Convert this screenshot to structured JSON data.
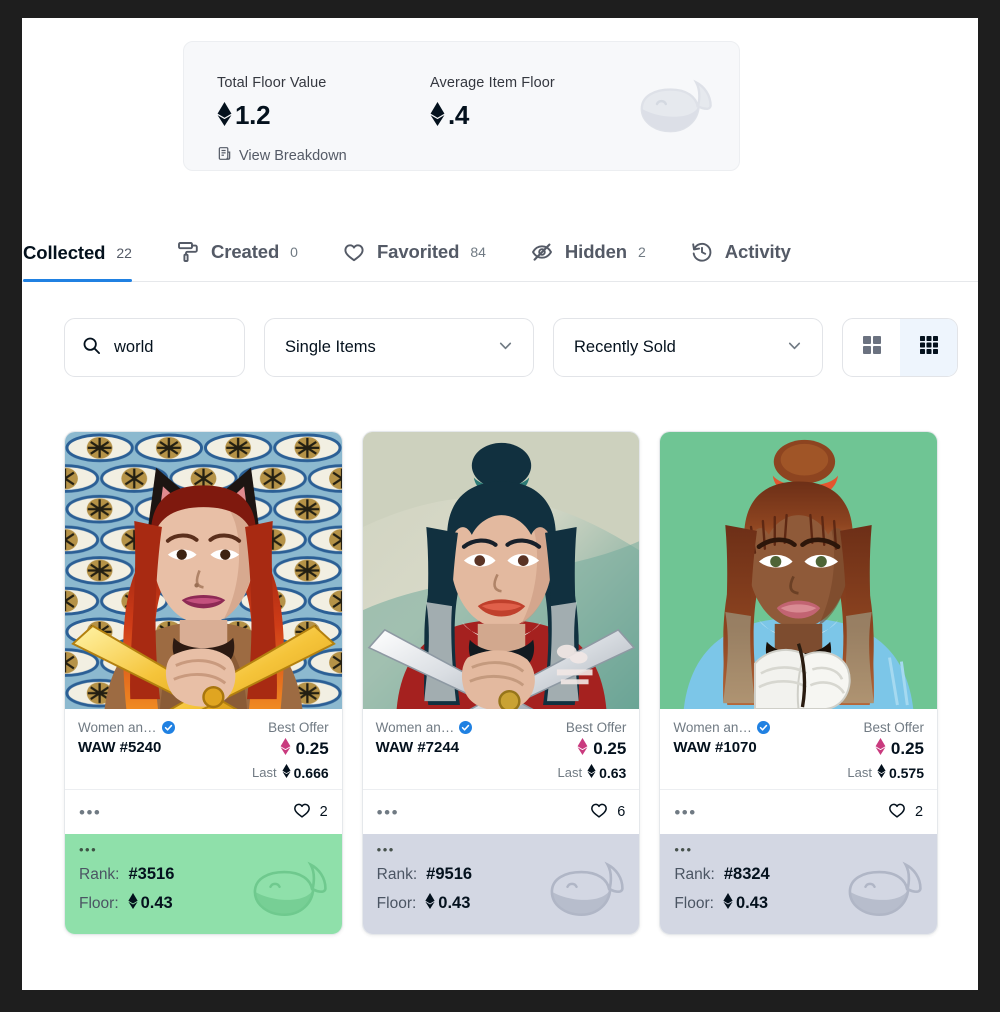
{
  "stats": {
    "total_floor_label": "Total Floor Value",
    "total_floor_value": "1.2",
    "avg_floor_label": "Average Item Floor",
    "avg_floor_value": ".4",
    "breakdown_label": "View Breakdown",
    "eth_symbol": "♦"
  },
  "tabs": [
    {
      "label": "Collected",
      "count": "22",
      "icon": "none",
      "active": true
    },
    {
      "label": "Created",
      "count": "0",
      "icon": "paint-roller-icon",
      "active": false
    },
    {
      "label": "Favorited",
      "count": "84",
      "icon": "heart-icon",
      "active": false
    },
    {
      "label": "Hidden",
      "count": "2",
      "icon": "eye-off-icon",
      "active": false
    },
    {
      "label": "Activity",
      "count": "",
      "icon": "history-icon",
      "active": false
    }
  ],
  "filters": {
    "search_value": "world",
    "search_placeholder": "Search",
    "item_type": "Single Items",
    "sort_by": "Recently Sold",
    "view_large_active": false,
    "view_small_active": true
  },
  "labels": {
    "best_offer": "Best Offer",
    "last": "Last",
    "rank": "Rank:",
    "floor": "Floor:",
    "dots": "•••"
  },
  "colors": {
    "accent": "#2081e2",
    "verified_blue": "#2081e2",
    "offer_pink": "#c93a7e",
    "rank_highlight_green": "#8fe0aa",
    "rank_default_gray": "#d3d7e3"
  },
  "cards": [
    {
      "collection": "Women an…",
      "name": "WAW #5240",
      "best_offer_price": "0.25",
      "last_price": "0.666",
      "fav_count": "2",
      "rank": "#3516",
      "floor": "0.43",
      "rank_bar_color": "#8fe0aa",
      "art": "orange-cat-ears-swords"
    },
    {
      "collection": "Women an…",
      "name": "WAW #7244",
      "best_offer_price": "0.25",
      "last_price": "0.63",
      "fav_count": "6",
      "rank": "#9516",
      "floor": "0.43",
      "rank_bar_color": "#d3d7e3",
      "art": "teal-blackhair-daggers"
    },
    {
      "collection": "Women an…",
      "name": "WAW #1070",
      "best_offer_price": "0.25",
      "last_price": "0.575",
      "fav_count": "2",
      "rank": "#8324",
      "floor": "0.43",
      "rank_bar_color": "#d3d7e3",
      "art": "green-bun-wrapped-hands"
    }
  ]
}
